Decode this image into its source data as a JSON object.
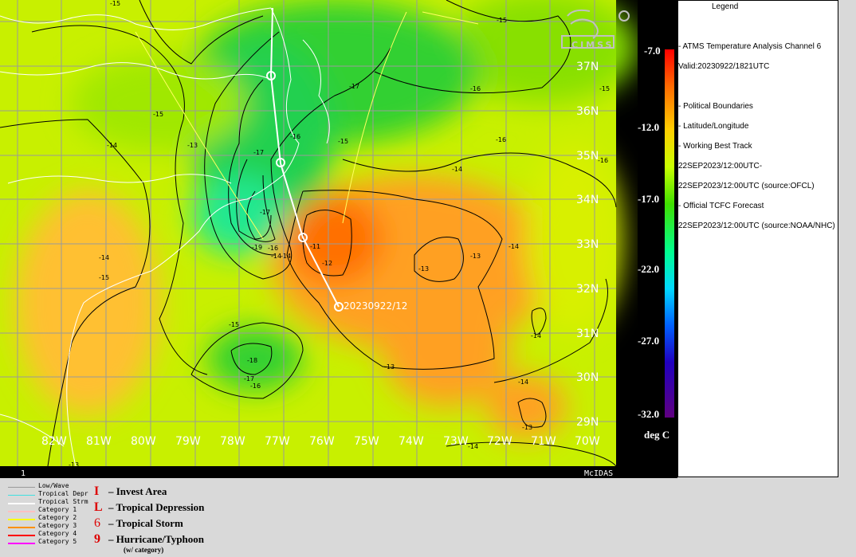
{
  "map": {
    "longitude_labels": [
      "82W",
      "81W",
      "80W",
      "79W",
      "78W",
      "77W",
      "76W",
      "75W",
      "74W",
      "73W",
      "72W",
      "71W",
      "70W"
    ],
    "latitude_labels": [
      "37N",
      "36N",
      "35N",
      "34N",
      "33N",
      "32N",
      "31N",
      "30N",
      "29N"
    ],
    "contour_labels": [
      "-15",
      "-15",
      "-15",
      "-14",
      "-13",
      "-15",
      "-17",
      "-16",
      "-15",
      "-16",
      "-17",
      "-16",
      "-14",
      "-17",
      "-19",
      "-16",
      "-14",
      "-11",
      "-12",
      "-14",
      "-13",
      "-13",
      "-14",
      "-15",
      "-18",
      "-17",
      "-16",
      "-13",
      "-14",
      "-14",
      "-13",
      "-14",
      "-13",
      "-14",
      "-15",
      "-16"
    ],
    "storm_label": "20230922/12",
    "frame_number": "1",
    "mcidas_label": "McIDAS",
    "logo_text": "CIMSS"
  },
  "colorbar": {
    "ticks": [
      "-7.0",
      "-12.0",
      "-17.0",
      "-22.0",
      "-27.0",
      "-32.0"
    ],
    "unit": "deg C"
  },
  "legend": {
    "title": "Legend",
    "product": "-  ATMS Temperature Analysis  Channel 6",
    "valid": "Valid:20230922/1821UTC",
    "political": "-  Political Boundaries",
    "latlon": "-  Latitude/Longitude",
    "best_track": "-  Working Best Track",
    "bt_from": "22SEP2023/12:00UTC-",
    "bt_to": "22SEP2023/12:00UTC   (source:OFCL)",
    "tcfc": "-  Official TCFC Forecast",
    "tcfc_src": "22SEP2023/12:00UTC  (source:NOAA/NHC)"
  },
  "track_key": [
    {
      "label": "Low/Wave",
      "color": "#9a9a9a"
    },
    {
      "label": "Tropical Depr",
      "color": "#40e0e0"
    },
    {
      "label": "Tropical Strm",
      "color": "#ffffff"
    },
    {
      "label": "Category 1",
      "color": "#ffc0c0"
    },
    {
      "label": "Category 2",
      "color": "#ffff00"
    },
    {
      "label": "Category 3",
      "color": "#ff9000"
    },
    {
      "label": "Category 4",
      "color": "#ff0000"
    },
    {
      "label": "Category 5",
      "color": "#ff00ff"
    }
  ],
  "symbol_key": [
    {
      "symbol": "I",
      "label": "– Invest Area"
    },
    {
      "symbol": "L",
      "label": "– Tropical Depression"
    },
    {
      "symbol": "6",
      "label": "– Tropical Storm"
    },
    {
      "symbol": "9",
      "label": "– Hurricane/Typhoon"
    }
  ],
  "symbol_note": "(w/ category)"
}
